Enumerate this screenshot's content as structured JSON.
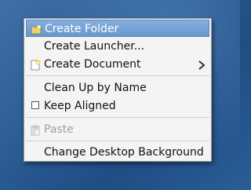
{
  "context_menu": {
    "items": [
      {
        "label": "Create Folder",
        "icon": "folder-new-icon",
        "highlighted": true
      },
      {
        "label": "Create Launcher..."
      },
      {
        "label": "Create Document",
        "icon": "document-new-icon",
        "submenu": true
      },
      {
        "label": "Clean Up by Name"
      },
      {
        "label": "Keep Aligned",
        "checkbox": "unchecked"
      },
      {
        "label": "Paste",
        "icon": "paste-icon",
        "disabled": true
      },
      {
        "label": "Change Desktop Background"
      }
    ]
  },
  "colors": {
    "highlight": "#6f9dd3",
    "menu_bg": "#f4f4f4",
    "desktop": "#2a5a92",
    "disabled_text": "#a0a0a0"
  }
}
